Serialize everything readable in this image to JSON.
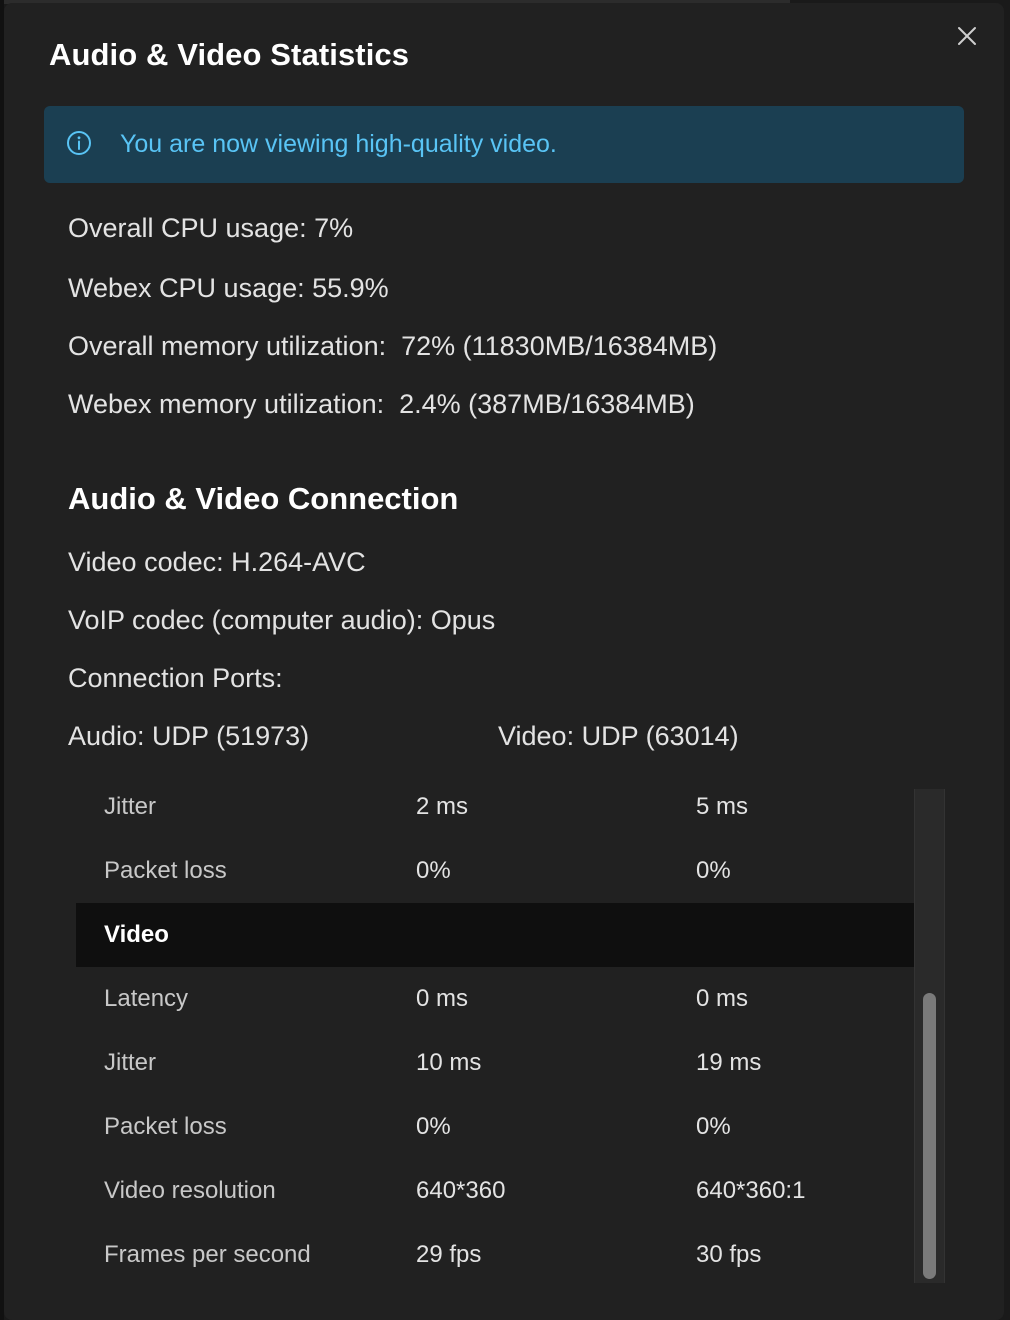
{
  "dialog": {
    "title": "Audio & Video Statistics",
    "close_icon": "close-icon"
  },
  "banner": {
    "icon": "info-icon",
    "text": "You are now viewing high-quality video."
  },
  "system": {
    "overall_cpu": "Overall CPU usage: 7%",
    "webex_cpu": "Webex CPU usage: 55.9%",
    "overall_memory": "Overall memory utilization:  72% (11830MB/16384MB)",
    "webex_memory": "Webex memory utilization:  2.4% (387MB/16384MB)"
  },
  "connection": {
    "title": "Audio & Video Connection",
    "video_codec": "Video codec: H.264-AVC",
    "voip_codec": "VoIP codec (computer audio): Opus",
    "ports_label": "Connection Ports:",
    "audio_port": "Audio: UDP (51973)",
    "video_port": "Video: UDP (63014)"
  },
  "table": {
    "rows": [
      {
        "label": "Jitter",
        "c1": "2 ms",
        "c2": "5 ms"
      },
      {
        "label": "Packet loss",
        "c1": "0%",
        "c2": "0%"
      },
      {
        "section": "Video"
      },
      {
        "label": "Latency",
        "c1": "0 ms",
        "c2": "0 ms"
      },
      {
        "label": "Jitter",
        "c1": "10 ms",
        "c2": "19 ms"
      },
      {
        "label": "Packet loss",
        "c1": "0%",
        "c2": "0%"
      },
      {
        "label": "Video resolution",
        "c1": "640*360",
        "c2": "640*360:1"
      },
      {
        "label": "Frames per second",
        "c1": "29 fps",
        "c2": "30 fps"
      }
    ]
  },
  "colors": {
    "dialog_bg": "#212121",
    "banner_bg": "#1b3f52",
    "banner_text": "#59c4f5",
    "section_row_bg": "#0f0f0f"
  }
}
